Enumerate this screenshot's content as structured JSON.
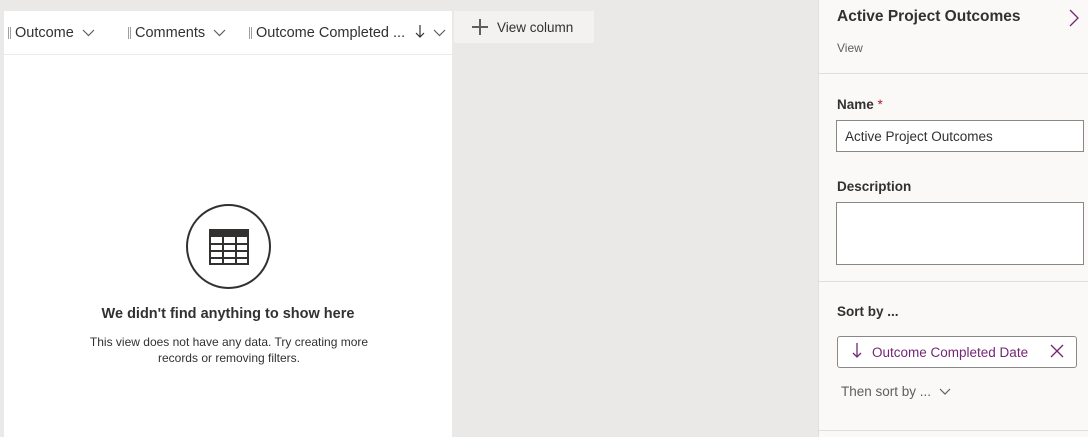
{
  "grid": {
    "columns": [
      {
        "label": "Outcome",
        "icon": "chevron-down-icon"
      },
      {
        "label": "Comments",
        "icon": "chevron-down-icon"
      },
      {
        "label": "Outcome Completed ...",
        "sort_icon": "arrow-down-icon",
        "icon": "chevron-down-icon"
      }
    ],
    "view_column_label": "View column",
    "empty_state": {
      "icon": "table-icon",
      "title": "We didn't find anything to show here",
      "description": "This view does not have any data. Try creating more records or removing filters."
    }
  },
  "panel": {
    "title": "Active Project Outcomes",
    "subtitle": "View",
    "name_label": "Name",
    "required_marker": "*",
    "name_value": "Active Project Outcomes",
    "description_label": "Description",
    "description_value": "",
    "sort_by_label": "Sort by ...",
    "sort_chip_label": "Outcome Completed Date",
    "then_sort_label": "Then sort by ..."
  },
  "colors": {
    "accent": "#742774",
    "required": "#a4262c",
    "canvas": "#ebe9e8"
  }
}
